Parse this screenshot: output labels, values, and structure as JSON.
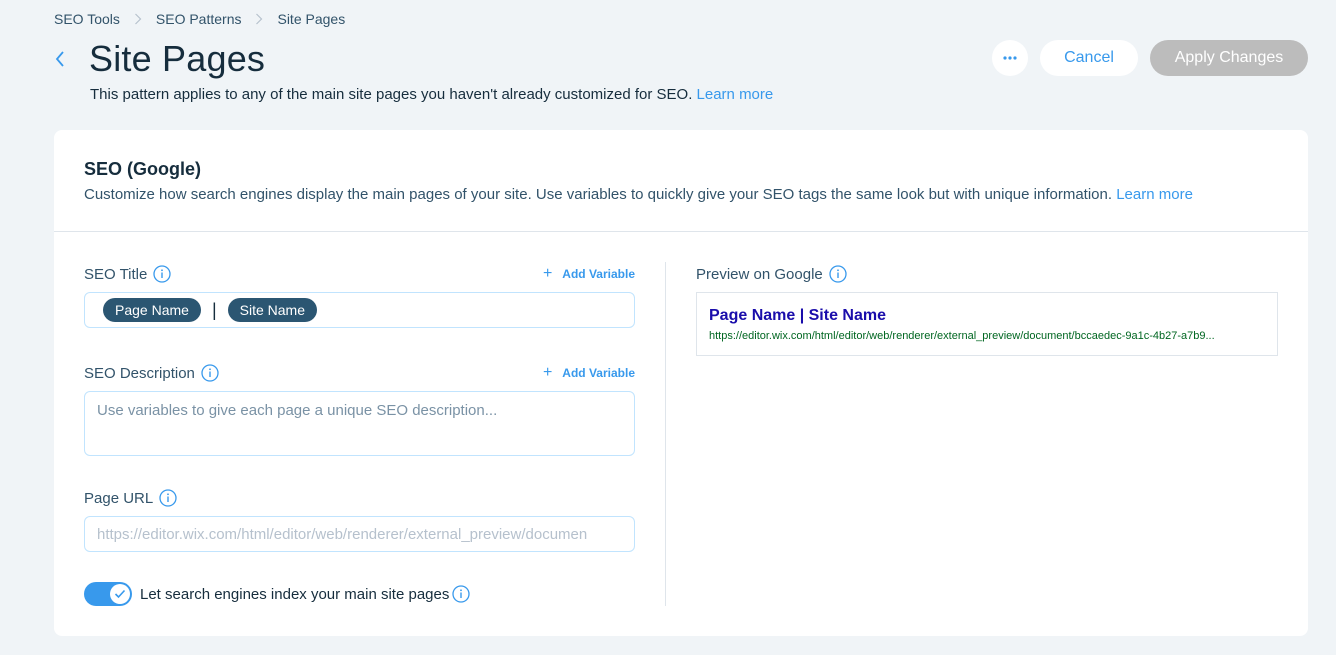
{
  "breadcrumb": [
    "SEO Tools",
    "SEO Patterns",
    "Site Pages"
  ],
  "header": {
    "title": "Site Pages",
    "subtitle": "This pattern applies to any of the main site pages you haven't already customized for SEO.",
    "learn_more": "Learn more",
    "cancel_label": "Cancel",
    "apply_label": "Apply Changes"
  },
  "card": {
    "title": "SEO (Google)",
    "description": "Customize how search engines display the main pages of your site. Use variables to quickly give your SEO tags the same look but with unique information.",
    "learn_more": "Learn more"
  },
  "seo_title": {
    "label": "SEO Title",
    "add_variable": "Add Variable",
    "chips": [
      "Page Name",
      "Site Name"
    ],
    "separator": "|"
  },
  "seo_description": {
    "label": "SEO Description",
    "add_variable": "Add Variable",
    "placeholder": "Use variables to give each page a unique SEO description..."
  },
  "page_url": {
    "label": "Page URL",
    "placeholder": "https://editor.wix.com/html/editor/web/renderer/external_preview/documen"
  },
  "index_toggle": {
    "label": "Let search engines index your main site pages",
    "on": true
  },
  "preview": {
    "label": "Preview on Google",
    "title": "Page Name | Site Name",
    "url": "https://editor.wix.com/html/editor/web/renderer/external_preview/document/bccaedec-9a1c-4b27-a7b9..."
  },
  "colors": {
    "accent": "#3899ec",
    "chip": "#2b5672",
    "preview_title": "#1a0dab",
    "preview_url": "#006621",
    "disabled_button": "#bcbcbc"
  }
}
